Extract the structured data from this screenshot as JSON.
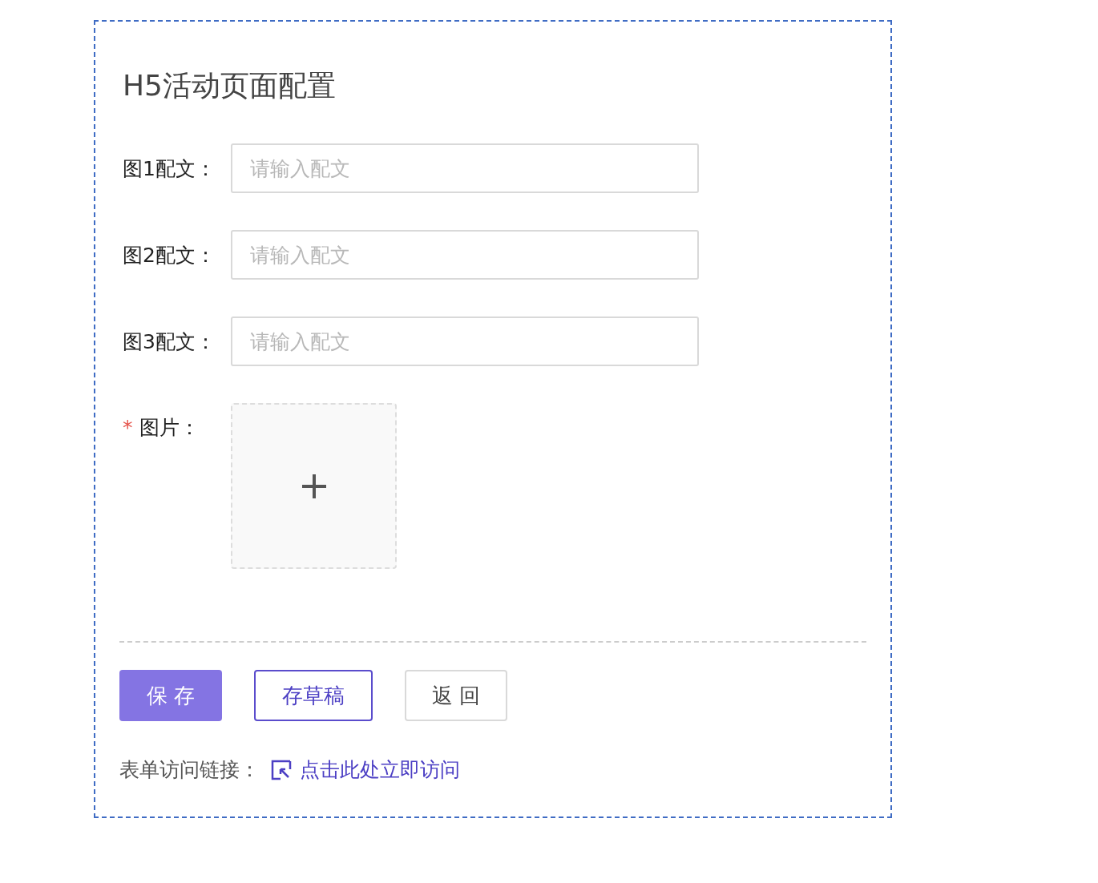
{
  "title": "H5活动页面配置",
  "fields": [
    {
      "label": "图1配文：",
      "placeholder": "请输入配文"
    },
    {
      "label": "图2配文：",
      "placeholder": "请输入配文"
    },
    {
      "label": "图3配文：",
      "placeholder": "请输入配文"
    }
  ],
  "image_upload": {
    "required_mark": "*",
    "label": "图片："
  },
  "buttons": [
    {
      "label": "保 存",
      "kind": "primary"
    },
    {
      "label": "存草稿",
      "kind": "outline"
    },
    {
      "label": "返 回",
      "kind": "default"
    }
  ],
  "access_link": {
    "label": "表单访问链接：",
    "link_text": "点击此处立即访问"
  }
}
